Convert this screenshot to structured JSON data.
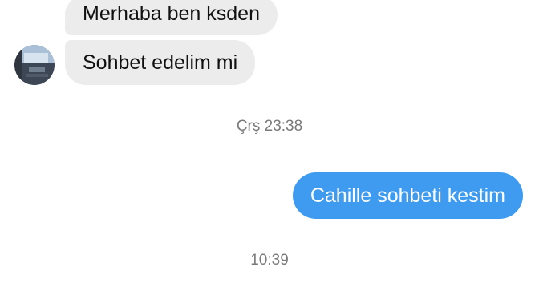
{
  "conversation": {
    "messages": [
      {
        "direction": "incoming",
        "text": "Merhaba ben ksden"
      },
      {
        "direction": "incoming",
        "text": "Sohbet edelim mi"
      },
      {
        "direction": "outgoing",
        "text": "Cahille sohbeti kestim"
      }
    ],
    "timestamps": [
      "Çrş 23:38",
      "10:39"
    ]
  },
  "colors": {
    "incoming_bubble": "#ececec",
    "outgoing_bubble": "#3e9bf0",
    "timestamp_text": "#7a7a7a"
  },
  "icons": {
    "avatar": "contact-avatar-icon"
  }
}
